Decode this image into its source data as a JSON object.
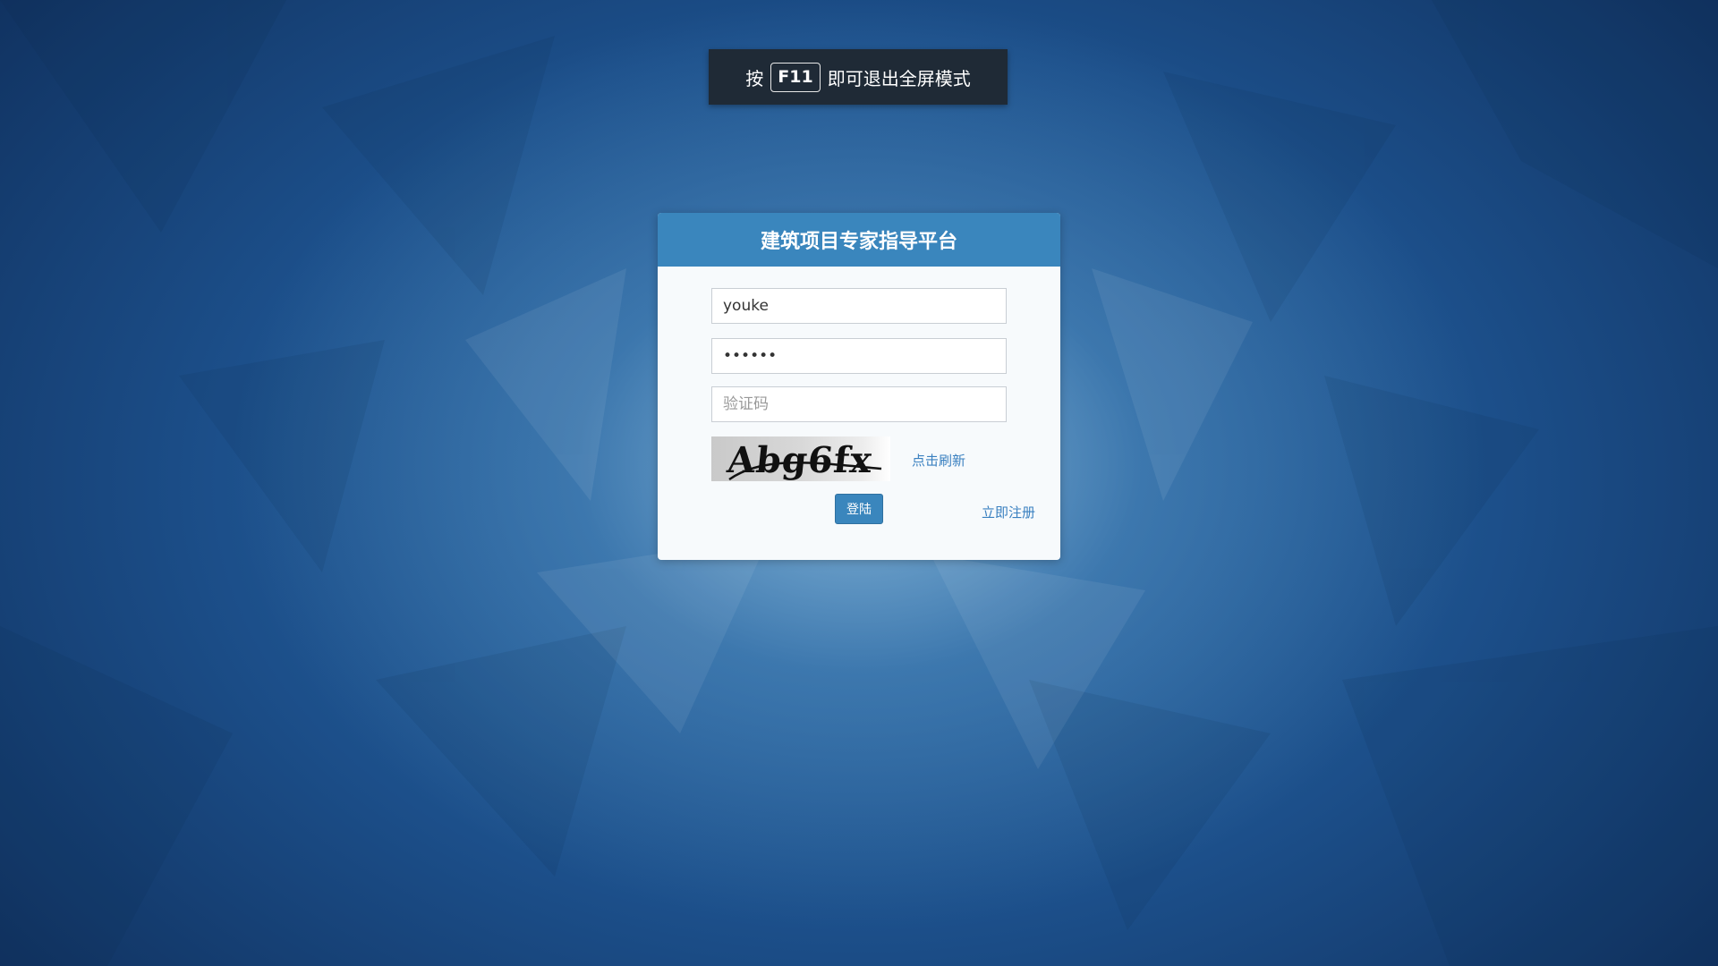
{
  "fullscreen_notice": {
    "prefix": "按",
    "key": "F11",
    "suffix": "即可退出全屏模式"
  },
  "login": {
    "title": "建筑项目专家指导平台",
    "username_value": "youke",
    "password_value": "youke1",
    "captcha_placeholder": "验证码",
    "captcha_text": "Abg6fx",
    "refresh_label": "点击刷新",
    "submit_label": "登陆",
    "register_label": "立即注册"
  },
  "colors": {
    "header": "#3a86bd",
    "link": "#3a80c0",
    "toast_bg": "#1f2a36"
  }
}
